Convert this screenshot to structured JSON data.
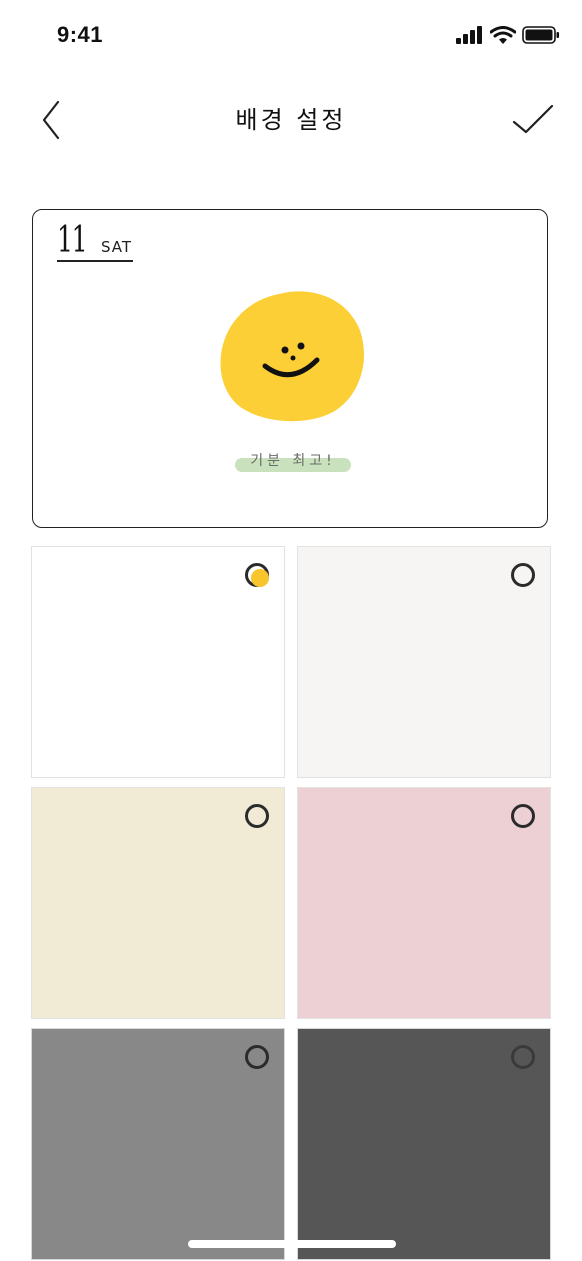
{
  "status": {
    "time": "9:41"
  },
  "nav": {
    "title": "배경 설정"
  },
  "preview": {
    "date_number": "11",
    "day": "SAT",
    "mood_label": "기분 최고!"
  },
  "swatches": [
    {
      "color": "#ffffff",
      "selected": true
    },
    {
      "color": "#f6f5f3",
      "selected": false
    },
    {
      "color": "#f1ead5",
      "selected": false
    },
    {
      "color": "#ecd0d4",
      "selected": false
    },
    {
      "color": "#888888",
      "selected": false
    },
    {
      "color": "#565656",
      "selected": false
    }
  ],
  "colors": {
    "accent": "#fbcc35",
    "mood_green": "#c9e2bd",
    "face_yellow": "#fbcf35"
  }
}
